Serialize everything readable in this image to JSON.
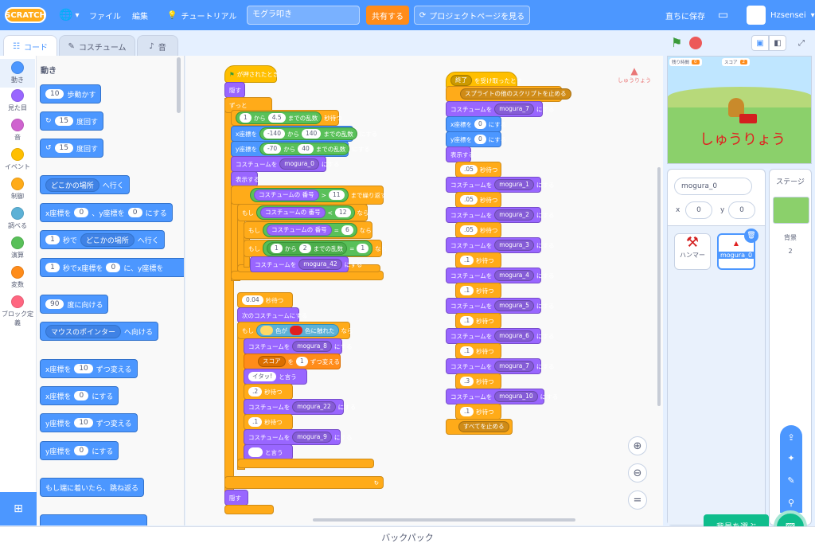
{
  "menubar": {
    "logo": "SCRATCH",
    "file": "ファイル",
    "edit": "編集",
    "tutorial": "チュートリアル",
    "project_title": "モグラ叩き",
    "share": "共有する",
    "project_page": "プロジェクトページを見る",
    "save_now": "直ちに保存",
    "username": "Hzsensei"
  },
  "tabs": {
    "code": "コード",
    "costume": "コスチューム",
    "sound": "音"
  },
  "categories": [
    {
      "label": "動き",
      "color": "#4c97ff"
    },
    {
      "label": "見た目",
      "color": "#9966ff"
    },
    {
      "label": "音",
      "color": "#cf63cf"
    },
    {
      "label": "イベント",
      "color": "#ffbf00"
    },
    {
      "label": "制御",
      "color": "#ffab19"
    },
    {
      "label": "調べる",
      "color": "#5cb1d6"
    },
    {
      "label": "演算",
      "color": "#59c059"
    },
    {
      "label": "変数",
      "color": "#ff8c1a"
    },
    {
      "label": "ブロック定義",
      "color": "#ff6680"
    }
  ],
  "palette": {
    "heading": "動き",
    "move": {
      "v": "10",
      "t": "歩動かす"
    },
    "turn_right": {
      "v": "15",
      "t": "度回す"
    },
    "turn_left": {
      "v": "15",
      "t": "度回す"
    },
    "goto": {
      "d": "どこかの場所",
      "t": "へ行く"
    },
    "gotoxy": {
      "a": "x座標を",
      "x": "0",
      "b": "、y座標を",
      "y": "0",
      "c": "にする"
    },
    "glide": {
      "v": "1",
      "a": "秒で",
      "d": "どこかの場所",
      "t": "へ行く"
    },
    "glidexy": {
      "v": "1",
      "a": "秒でx座標を",
      "x": "0",
      "b": "に、y座標を"
    },
    "point": {
      "v": "90",
      "t": "度に向ける"
    },
    "pointto": {
      "d": "マウスのポインター",
      "t": "へ向ける"
    },
    "changex": {
      "a": "x座標を",
      "v": "10",
      "t": "ずつ変える"
    },
    "setx": {
      "a": "x座標を",
      "v": "0",
      "t": "にする"
    },
    "changey": {
      "a": "y座標を",
      "v": "10",
      "t": "ずつ変える"
    },
    "sety": {
      "a": "y座標を",
      "v": "0",
      "t": "にする"
    },
    "bounce": "もし端に着いたら、跳ね返る"
  },
  "script1": {
    "flag": "が押されたとき",
    "hide": "隠す",
    "forever": "ずっと",
    "wait_rand": {
      "a": "1",
      "b": "から",
      "c": "4.5",
      "d": "までの乱数",
      "e": "秒待つ"
    },
    "setx": {
      "a": "x座標を",
      "b": "-140",
      "c": "から",
      "d": "140",
      "e": "までの乱数",
      "f": "にする"
    },
    "sety": {
      "a": "y座標を",
      "b": "-70",
      "c": "から",
      "d": "40",
      "e": "までの乱数",
      "f": "にする"
    },
    "costume0": {
      "a": "コスチュームを",
      "d": "mogura_0",
      "t": "にする"
    },
    "show": "表示する",
    "repeat_until": {
      "a": "コスチュームの",
      "d": "番号",
      "op": ">",
      "v": "11",
      "t": "まで繰り返す"
    },
    "if1": {
      "a": "もし",
      "b": "コスチュームの",
      "d": "番号",
      "op": "<",
      "v": "12",
      "t": "なら"
    },
    "if2": {
      "a": "もし",
      "b": "コスチュームの",
      "d": "番号",
      "op": "=",
      "v": "6",
      "t": "なら"
    },
    "if3": {
      "a": "もし",
      "v1": "1",
      "b": "から",
      "v2": "2",
      "c": "までの乱数",
      "op": "=",
      "v3": "1",
      "t": "なら"
    },
    "costume42": {
      "a": "コスチュームを",
      "d": "mogura_42",
      "t": "にする"
    },
    "wait004": {
      "v": "0.04",
      "t": "秒待つ"
    },
    "next": "次のコスチュームにする",
    "iftouch": {
      "a": "もし",
      "b": "色が",
      "c": "色に触れた",
      "t": "なら",
      "c1": "#ffd966",
      "c2": "#e02020"
    },
    "costume8": {
      "a": "コスチュームを",
      "d": "mogura_8",
      "t": "にする"
    },
    "score": {
      "a": "スコア",
      "b": "を",
      "v": "1",
      "t": "ずつ変える"
    },
    "say": {
      "v": "イタッ!",
      "t": "と言う"
    },
    "wait2": {
      "v": ".2",
      "t": "秒待つ"
    },
    "costume22": {
      "a": "コスチュームを",
      "d": "mogura_22",
      "t": "にする"
    },
    "wait1": {
      "v": ".1",
      "t": "秒待つ"
    },
    "costume9": {
      "a": "コスチュームを",
      "d": "mogura_9",
      "t": "にする"
    },
    "say2": {
      "v": "",
      "t": "と言う"
    },
    "hide2": "隠す"
  },
  "script2": {
    "recv": {
      "d": "終了",
      "t": "を受け取ったとき"
    },
    "stop_other": {
      "d": "スプライトの他のスクリプトを止める"
    },
    "costume7": {
      "a": "コスチュームを",
      "d": "mogura_7",
      "t": "にする"
    },
    "setx": {
      "a": "x座標を",
      "v": "0",
      "t": "にする"
    },
    "sety": {
      "a": "y座標を",
      "v": "0",
      "t": "にする"
    },
    "show": "表示する",
    "seq": [
      {
        "w": ".05",
        "d": "mogura_1"
      },
      {
        "w": ".05",
        "d": "mogura_2"
      },
      {
        "w": ".05",
        "d": "mogura_3"
      },
      {
        "w": ".1",
        "d": "mogura_4"
      },
      {
        "w": ".1",
        "d": "mogura_5"
      },
      {
        "w": ".1",
        "d": "mogura_6"
      },
      {
        "w": ".1",
        "d": "mogura_7"
      },
      {
        "w": ".3",
        "d": "mogura_10"
      }
    ],
    "wait_t": "秒待つ",
    "costume_a": "コスチュームを",
    "costume_t": "にする",
    "final_wait": ".1",
    "stop_all": "すべてを止める"
  },
  "workspace_sprite_label": "しゅうりょう",
  "stage": {
    "var1_label": "残り時間",
    "var1_value": "0",
    "var2_label": "スコア",
    "var2_value": "2",
    "text": "しゅうりょう"
  },
  "sprite_info": {
    "name": "mogura_0",
    "x_label": "x",
    "x": "0",
    "y_label": "y",
    "y": "0"
  },
  "sprites": [
    {
      "name": "ハンマー"
    },
    {
      "name": "mogura_0"
    }
  ],
  "stage_pane": {
    "title": "ステージ",
    "backdrop_label": "背景",
    "backdrop_count": "2"
  },
  "backdrop_button": "背景を選ぶ",
  "backpack": "バックパック"
}
